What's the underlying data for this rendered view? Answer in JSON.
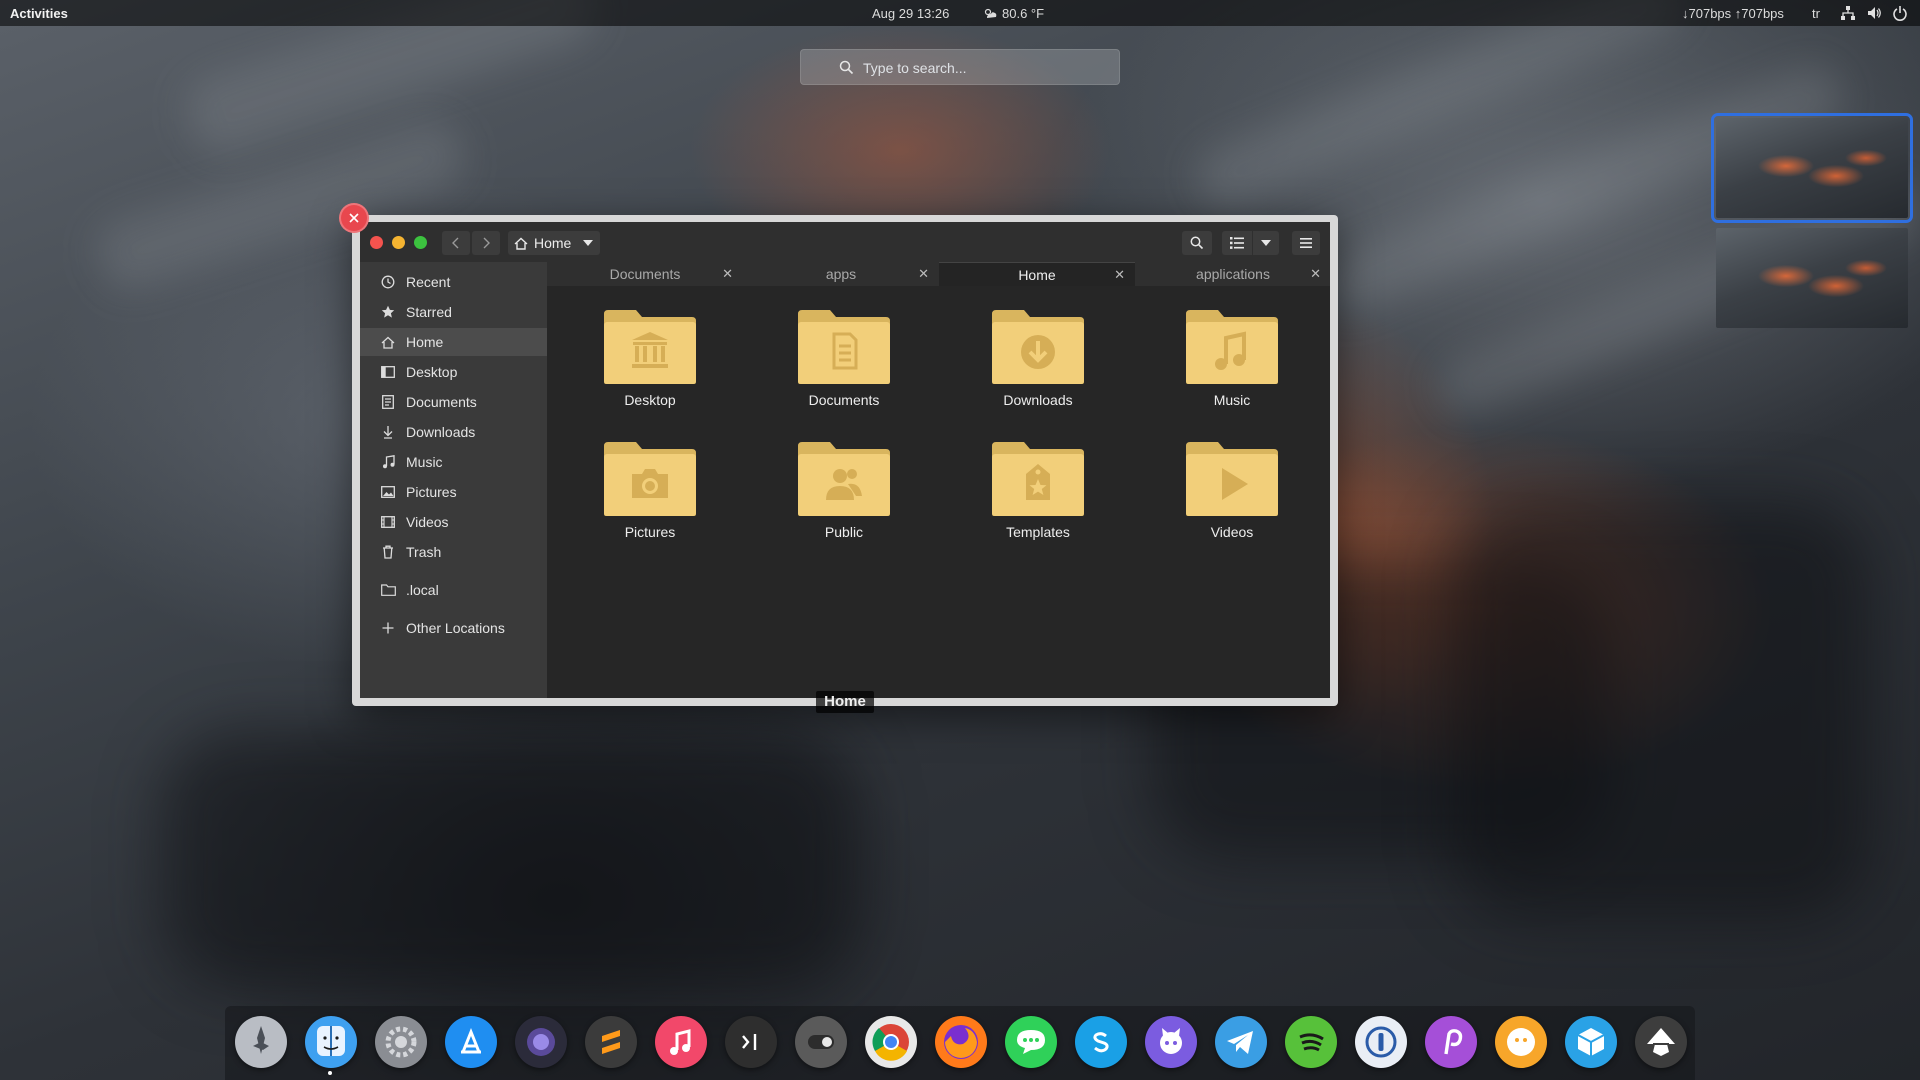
{
  "topbar": {
    "activities": "Activities",
    "clock": "Aug 29  13:26",
    "weather": "80.6 °F",
    "network_speed": "↓707bps ↑707bps",
    "keyboard_layout": "tr",
    "tray_icons": [
      "network-icon",
      "volume-icon",
      "power-icon"
    ]
  },
  "search": {
    "placeholder": "Type to search..."
  },
  "workspaces": {
    "count": 2,
    "active_index": 0
  },
  "window": {
    "path_label": "Home",
    "sidebar": [
      {
        "label": "Recent",
        "icon": "clock-icon"
      },
      {
        "label": "Starred",
        "icon": "star-icon"
      },
      {
        "label": "Home",
        "icon": "home-icon",
        "active": true
      },
      {
        "label": "Desktop",
        "icon": "desktop-icon"
      },
      {
        "label": "Documents",
        "icon": "document-icon"
      },
      {
        "label": "Downloads",
        "icon": "download-icon"
      },
      {
        "label": "Music",
        "icon": "music-icon"
      },
      {
        "label": "Pictures",
        "icon": "picture-icon"
      },
      {
        "label": "Videos",
        "icon": "video-icon"
      },
      {
        "label": "Trash",
        "icon": "trash-icon"
      },
      {
        "label": ".local",
        "icon": "folder-icon"
      },
      {
        "label": "Other Locations",
        "icon": "plus-icon"
      }
    ],
    "tabs": [
      {
        "label": "Documents"
      },
      {
        "label": "apps"
      },
      {
        "label": "Home",
        "active": true
      },
      {
        "label": "applications"
      }
    ],
    "tab_close_glyph": "✕",
    "folders": [
      {
        "label": "Desktop",
        "icon": "bank-emblem-icon"
      },
      {
        "label": "Documents",
        "icon": "document-emblem-icon"
      },
      {
        "label": "Downloads",
        "icon": "download-emblem-icon"
      },
      {
        "label": "Music",
        "icon": "music-emblem-icon"
      },
      {
        "label": "Pictures",
        "icon": "camera-emblem-icon"
      },
      {
        "label": "Public",
        "icon": "person-emblem-icon"
      },
      {
        "label": "Templates",
        "icon": "template-emblem-icon"
      },
      {
        "label": "Videos",
        "icon": "play-emblem-icon"
      }
    ],
    "window_label": "Home",
    "folder_color": "#f2cf7a"
  },
  "dock": {
    "apps": [
      {
        "name": "launchpad-rocket-icon",
        "color": "#b9bdc4"
      },
      {
        "name": "finder-icon",
        "color": "#3ea0f0",
        "running": true
      },
      {
        "name": "system-settings-gear-icon",
        "color": "#8a8d93"
      },
      {
        "name": "app-store-icon",
        "color": "#1f8ef1"
      },
      {
        "name": "screenshot-lens-icon",
        "color": "#2b2b3a"
      },
      {
        "name": "sublime-text-icon",
        "color": "#3b3b3b"
      },
      {
        "name": "music-note-icon",
        "color": "#f2486a"
      },
      {
        "name": "terminal-icon",
        "color": "#2e2e2e"
      },
      {
        "name": "toggle-switch-icon",
        "color": "#5a5a5a"
      },
      {
        "name": "chrome-icon",
        "color": "#e8e8e8"
      },
      {
        "name": "firefox-icon",
        "color": "#ff7a1a"
      },
      {
        "name": "messages-icon",
        "color": "#2fd159"
      },
      {
        "name": "skype-icon",
        "color": "#1aa0e6"
      },
      {
        "name": "github-desktop-icon",
        "color": "#7b5ce0"
      },
      {
        "name": "telegram-icon",
        "color": "#3a9ee4"
      },
      {
        "name": "spotify-icon",
        "color": "#57c13a"
      },
      {
        "name": "1password-icon",
        "color": "#e9eef5"
      },
      {
        "name": "pinterest-p-icon",
        "color": "#a54fd8"
      },
      {
        "name": "finder-face-icon",
        "color": "#f7a62a"
      },
      {
        "name": "box-icon",
        "color": "#2aa2e6"
      },
      {
        "name": "inkscape-icon",
        "color": "#3d3d3d"
      }
    ]
  }
}
